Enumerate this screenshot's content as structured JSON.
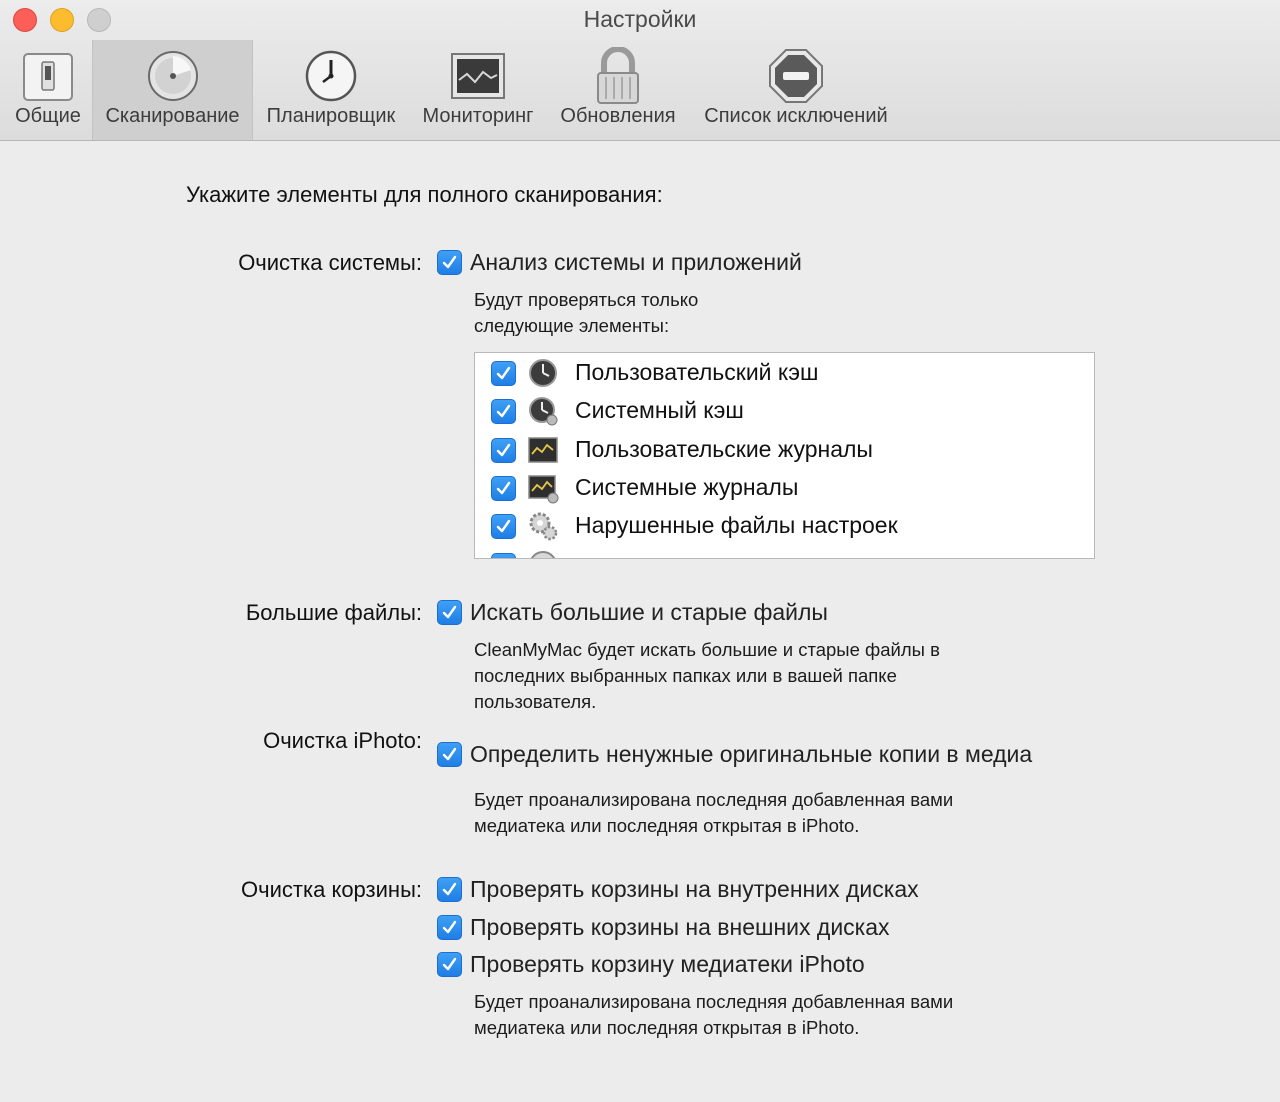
{
  "window": {
    "title": "Настройки",
    "traffic_lights": [
      "close",
      "minimize",
      "zoom"
    ]
  },
  "tabs": [
    {
      "label": "Общие",
      "icon": "switch-icon",
      "selected": false
    },
    {
      "label": "Сканирование",
      "icon": "disk-icon",
      "selected": true
    },
    {
      "label": "Планировщик",
      "icon": "clock-icon",
      "selected": false
    },
    {
      "label": "Мониторинг",
      "icon": "monitor-icon",
      "selected": false
    },
    {
      "label": "Обновления",
      "icon": "lock-icon",
      "selected": false
    },
    {
      "label": "Список исключений",
      "icon": "stop-icon",
      "selected": false
    }
  ],
  "heading": "Укажите элементы для полного сканирования:",
  "system_cleanup": {
    "label": "Очистка системы:",
    "option": "Анализ системы и приложений",
    "checked": true,
    "desc_line1": "Будут проверяться только",
    "desc_line2": "следующие элементы:",
    "items": [
      {
        "label": "Пользовательский кэш",
        "icon": "cache-clock-icon",
        "checked": true
      },
      {
        "label": "Системный кэш",
        "icon": "system-cache-icon",
        "checked": true
      },
      {
        "label": "Пользовательские журналы",
        "icon": "log-console-icon",
        "checked": true
      },
      {
        "label": "Системные журналы",
        "icon": "system-log-icon",
        "checked": true
      },
      {
        "label": "Нарушенные файлы настроек",
        "icon": "gears-icon",
        "checked": true
      }
    ]
  },
  "large_files": {
    "label": "Большие файлы:",
    "option": "Искать большие и старые файлы",
    "checked": true,
    "desc_line1": "CleanMyMac будет искать большие и старые файлы в",
    "desc_line2": "последних выбранных папках или в вашей папке",
    "desc_line3": "пользователя."
  },
  "iphoto": {
    "label": "Очистка iPhoto:",
    "option": "Определить ненужные оригинальные копии в медиа",
    "checked": true,
    "desc_line1": "Будет проанализирована последняя добавленная вами",
    "desc_line2": "медиатека или последняя открытая в iPhoto."
  },
  "trash": {
    "label": "Очистка корзины:",
    "options": [
      {
        "label": "Проверять корзины на внутренних дисках",
        "checked": true
      },
      {
        "label": "Проверять корзины на внешних дисках",
        "checked": true
      },
      {
        "label": "Проверять корзину медиатеки iPhoto",
        "checked": true
      }
    ],
    "desc_line1": "Будет проанализирована последняя добавленная вами",
    "desc_line2": "медиатека или последняя открытая в iPhoto."
  },
  "colors": {
    "checkbox_blue": "#2a8cf0",
    "selected_tab": "#cfcfcf",
    "window_bg": "#ececec"
  }
}
